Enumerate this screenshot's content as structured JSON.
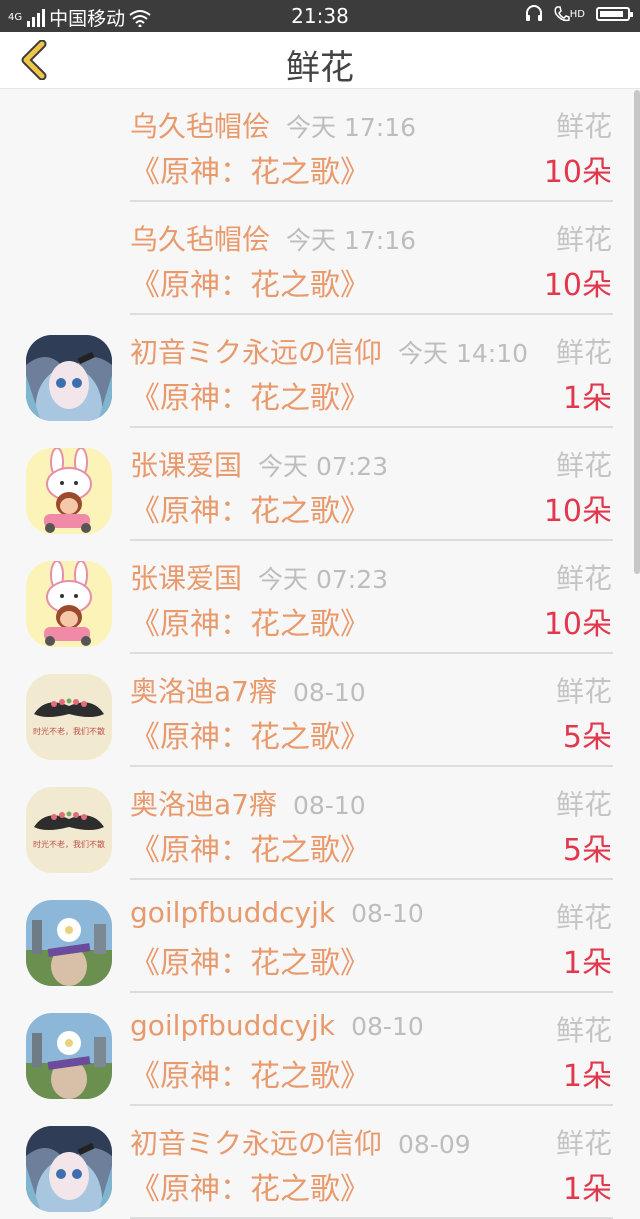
{
  "status": {
    "network_label": "4G",
    "carrier": "中国移动",
    "time": "21:38",
    "hd_label": "HD",
    "battery_fraction": 0.9
  },
  "header": {
    "title": "鲜花"
  },
  "rows": [
    {
      "name": "乌久毡帽侩",
      "time": "今天 17:16",
      "work": "《原神：花之歌》",
      "kind": "鲜花",
      "count": "10朵",
      "avatar": "none"
    },
    {
      "name": "乌久毡帽侩",
      "time": "今天 17:16",
      "work": "《原神：花之歌》",
      "kind": "鲜花",
      "count": "10朵",
      "avatar": "none"
    },
    {
      "name": "初音ミク永远の信仰",
      "time": "今天 14:10",
      "work": "《原神：花之歌》",
      "kind": "鲜花",
      "count": "1朵",
      "avatar": "anime"
    },
    {
      "name": "张课爱国",
      "time": "今天 07:23",
      "work": "《原神：花之歌》",
      "kind": "鲜花",
      "count": "10朵",
      "avatar": "rabbit"
    },
    {
      "name": "张课爱国",
      "time": "今天 07:23",
      "work": "《原神：花之歌》",
      "kind": "鲜花",
      "count": "10朵",
      "avatar": "rabbit"
    },
    {
      "name": "奥洛迪a7瘠",
      "time": "08-10",
      "work": "《原神：花之歌》",
      "kind": "鲜花",
      "count": "5朵",
      "avatar": "mustache"
    },
    {
      "name": "奥洛迪a7瘠",
      "time": "08-10",
      "work": "《原神：花之歌》",
      "kind": "鲜花",
      "count": "5朵",
      "avatar": "mustache"
    },
    {
      "name": "goilpfbuddcyjk",
      "time": "08-10",
      "work": "《原神：花之歌》",
      "kind": "鲜花",
      "count": "1朵",
      "avatar": "photo"
    },
    {
      "name": "goilpfbuddcyjk",
      "time": "08-10",
      "work": "《原神：花之歌》",
      "kind": "鲜花",
      "count": "1朵",
      "avatar": "photo"
    },
    {
      "name": "初音ミク永远の信仰",
      "time": "08-09",
      "work": "《原神：花之歌》",
      "kind": "鲜花",
      "count": "1朵",
      "avatar": "anime"
    }
  ],
  "avatar_text": {
    "mustache": "时光不老，我们不散"
  },
  "colors": {
    "accent": "#e89a6c",
    "count": "#e2384d",
    "back": "#f0c648"
  }
}
